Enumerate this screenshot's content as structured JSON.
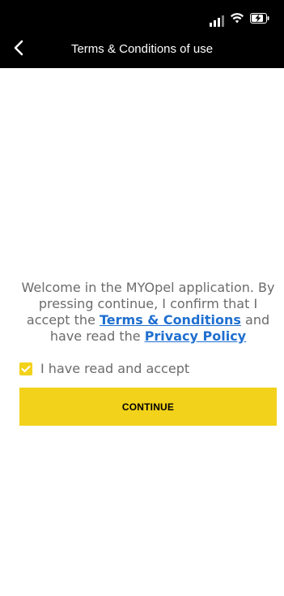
{
  "header": {
    "title": "Terms & Conditions of use",
    "back_icon": "chevron-left-icon"
  },
  "status_bar": {
    "icons": [
      "signal-icon",
      "wifi-icon",
      "battery-charging-icon"
    ]
  },
  "welcome": {
    "text_before_terms": "Welcome in the MYOpel application. By pressing continue, I confirm that I accept the ",
    "terms_link": "Terms & Conditions",
    "text_between": " and have read the ",
    "privacy_link": "Privacy Policy"
  },
  "accept": {
    "label": "I have read and accept",
    "checked": true
  },
  "continue_button": {
    "label": "CONTINUE"
  },
  "colors": {
    "accent": "#f2d21a",
    "header_bg": "#000000",
    "link": "#1f6fd0",
    "text": "#6b6b6b"
  }
}
